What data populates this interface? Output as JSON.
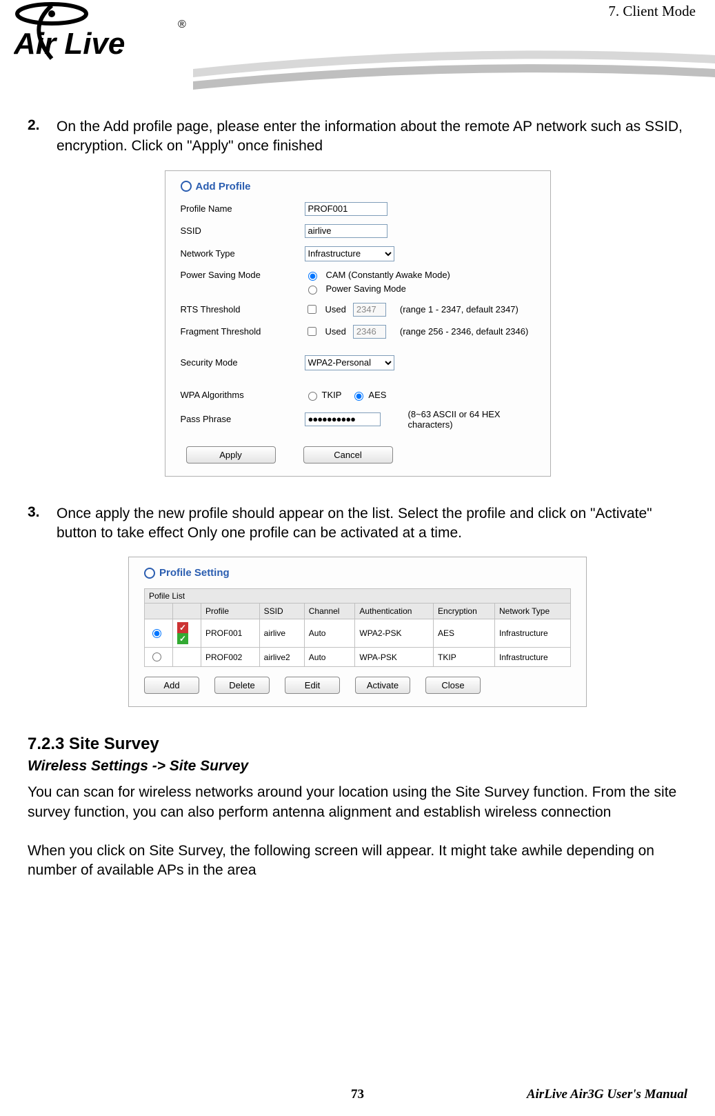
{
  "header": {
    "chapter_label": "7.  Client Mode",
    "logo_text": "Air Live",
    "logo_reg": "®"
  },
  "step2": {
    "num": "2.",
    "text": "On the Add profile page, please enter the information about the remote AP network such as SSID, encryption.   Click on \"Apply\" once finished"
  },
  "add_profile": {
    "panel_title": "Add Profile",
    "labels": {
      "profile_name": "Profile Name",
      "ssid": "SSID",
      "network_type": "Network Type",
      "power_mode": "Power Saving Mode",
      "rts": "RTS Threshold",
      "frag": "Fragment Threshold",
      "security": "Security Mode",
      "wpa_alg": "WPA Algorithms",
      "pass": "Pass Phrase"
    },
    "values": {
      "profile_name": "PROF001",
      "ssid": "airlive",
      "network_type": "Infrastructure",
      "power_cam": "CAM (Constantly Awake Mode)",
      "power_save": "Power Saving Mode",
      "used": "Used",
      "rts_val": "2347",
      "rts_note": "(range 1 - 2347, default 2347)",
      "frag_val": "2346",
      "frag_note": "(range 256 - 2346, default 2346)",
      "security": "WPA2-Personal",
      "tkip": "TKIP",
      "aes": "AES",
      "pass": "●●●●●●●●●●",
      "pass_note": "(8~63 ASCII or 64 HEX characters)"
    },
    "buttons": {
      "apply": "Apply",
      "cancel": "Cancel"
    }
  },
  "step3": {
    "num": "3.",
    "text": "Once apply the new profile should appear on the list.   Select the profile and click on \"Activate\" button to take effect   Only one profile can be activated at a time."
  },
  "profile_setting": {
    "panel_title": "Profile Setting",
    "list_label": "Pofile List",
    "headers": [
      "",
      "",
      "Profile",
      "SSID",
      "Channel",
      "Authentication",
      "Encryption",
      "Network Type"
    ],
    "rows": [
      {
        "selected": true,
        "active": true,
        "profile": "PROF001",
        "ssid": "airlive",
        "channel": "Auto",
        "auth": "WPA2-PSK",
        "enc": "AES",
        "nt": "Infrastructure"
      },
      {
        "selected": false,
        "active": false,
        "profile": "PROF002",
        "ssid": "airlive2",
        "channel": "Auto",
        "auth": "WPA-PSK",
        "enc": "TKIP",
        "nt": "Infrastructure"
      }
    ],
    "buttons": {
      "add": "Add",
      "delete": "Delete",
      "edit": "Edit",
      "activate": "Activate",
      "close": "Close"
    }
  },
  "section": {
    "heading": "7.2.3 Site Survey",
    "sub": "Wireless Settings -> Site Survey",
    "p1": "You can scan for wireless networks around your location using the Site Survey function. From the site survey function, you can also perform antenna alignment and establish wireless connection",
    "p2": "When you click on Site Survey, the following screen will appear. It might take awhile depending on number of available APs in the area"
  },
  "footer": {
    "page": "73",
    "manual": "AirLive Air3G User's Manual"
  }
}
